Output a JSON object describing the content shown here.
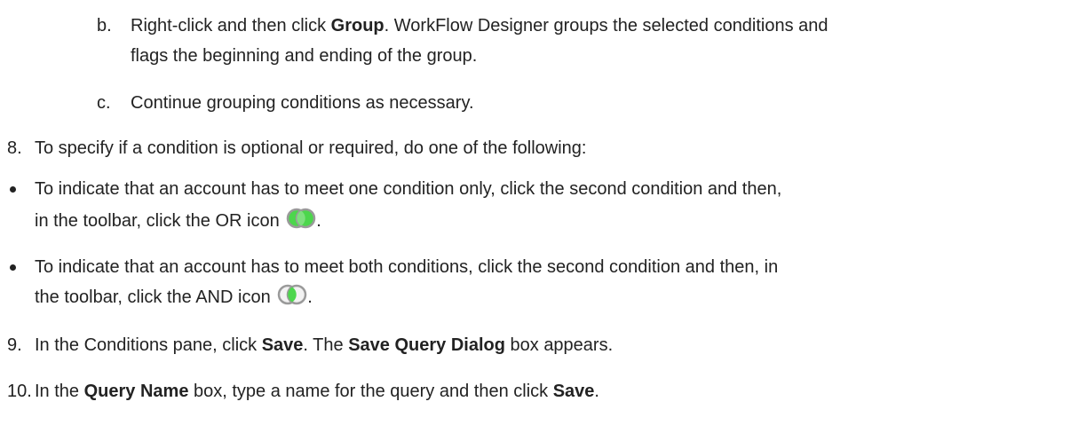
{
  "steps": {
    "b": {
      "marker": "b.",
      "lead": "Right-click and then click ",
      "bold": "Group",
      "rest_line1": ". WorkFlow Designer groups the selected conditions and",
      "line2": "flags the beginning and ending of the group."
    },
    "c": {
      "marker": "c.",
      "text": "Continue grouping conditions as necessary."
    },
    "s8": {
      "marker": "8.",
      "text": "To specify if a condition is optional or required, do one of the following:"
    },
    "bullet1": {
      "line1": "To indicate that an account has to meet one condition only, click the second condition and then,",
      "line2": "in the toolbar, click the OR icon",
      "after_icon": ".",
      "icon": "or-icon"
    },
    "bullet2": {
      "line1": "To indicate that an account has to meet both conditions, click the second condition and then, in",
      "line2": "the toolbar, click the AND icon",
      "after_icon": ".",
      "icon": "and-icon"
    },
    "s9": {
      "marker": "9.",
      "lead": "In the Conditions pane, click ",
      "bold1": "Save",
      "mid": ". The ",
      "bold2": "Save Query Dialog",
      "rest": " box appears."
    },
    "s10": {
      "marker": "10.",
      "lead": "In the ",
      "bold1": "Query Name",
      "mid": " box, type a name for the query and then click ",
      "bold2": "Save",
      "rest": "."
    }
  },
  "colors": {
    "text": "#222222",
    "icon_ring": "#a8a8a8",
    "icon_green": "#4cd64c"
  }
}
